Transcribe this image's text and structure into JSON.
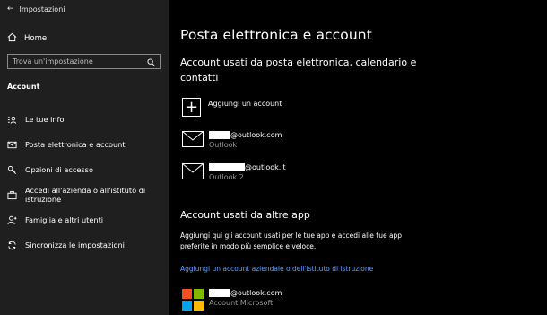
{
  "window": {
    "title": "Impostazioni"
  },
  "sidebar": {
    "home_label": "Home",
    "search_placeholder": "Trova un'impostazione",
    "section_title": "Account",
    "items": [
      {
        "label": "Le tue info",
        "icon": "person-card-icon"
      },
      {
        "label": "Posta elettronica e account",
        "icon": "mail-icon",
        "selected": true
      },
      {
        "label": "Opzioni di accesso",
        "icon": "key-icon"
      },
      {
        "label": "Accedi all'azienda o all'istituto di istruzione",
        "icon": "briefcase-icon"
      },
      {
        "label": "Famiglia e altri utenti",
        "icon": "person-add-icon"
      },
      {
        "label": "Sincronizza le impostazioni",
        "icon": "sync-icon"
      }
    ]
  },
  "main": {
    "title": "Posta elettronica e account",
    "subheading": "Account usati da posta elettronica, calendario e contatti",
    "add_account_label": "Aggiungi un account",
    "accounts": [
      {
        "email": "@outlook.com",
        "provider": "Outlook"
      },
      {
        "email": "@outlook.it",
        "provider": "Outlook 2"
      }
    ],
    "other_apps_heading": "Account usati da altre app",
    "other_apps_text": "Aggiungi qui gli account usati per le tue app e accedi alle tue app preferite in modo più semplice e veloce.",
    "work_link": "Aggiungi un account aziendale o dell'istituto di istruzione",
    "microsoft_account": {
      "email": "@outlook.com",
      "provider": "Account Microsoft"
    }
  },
  "colors": {
    "sidebar_bg": "#1f1f1f",
    "main_bg": "#000000",
    "link": "#5aa0ff",
    "ms_red": "#f25022",
    "ms_green": "#7fba00",
    "ms_blue": "#00a4ef",
    "ms_yellow": "#ffb900"
  }
}
